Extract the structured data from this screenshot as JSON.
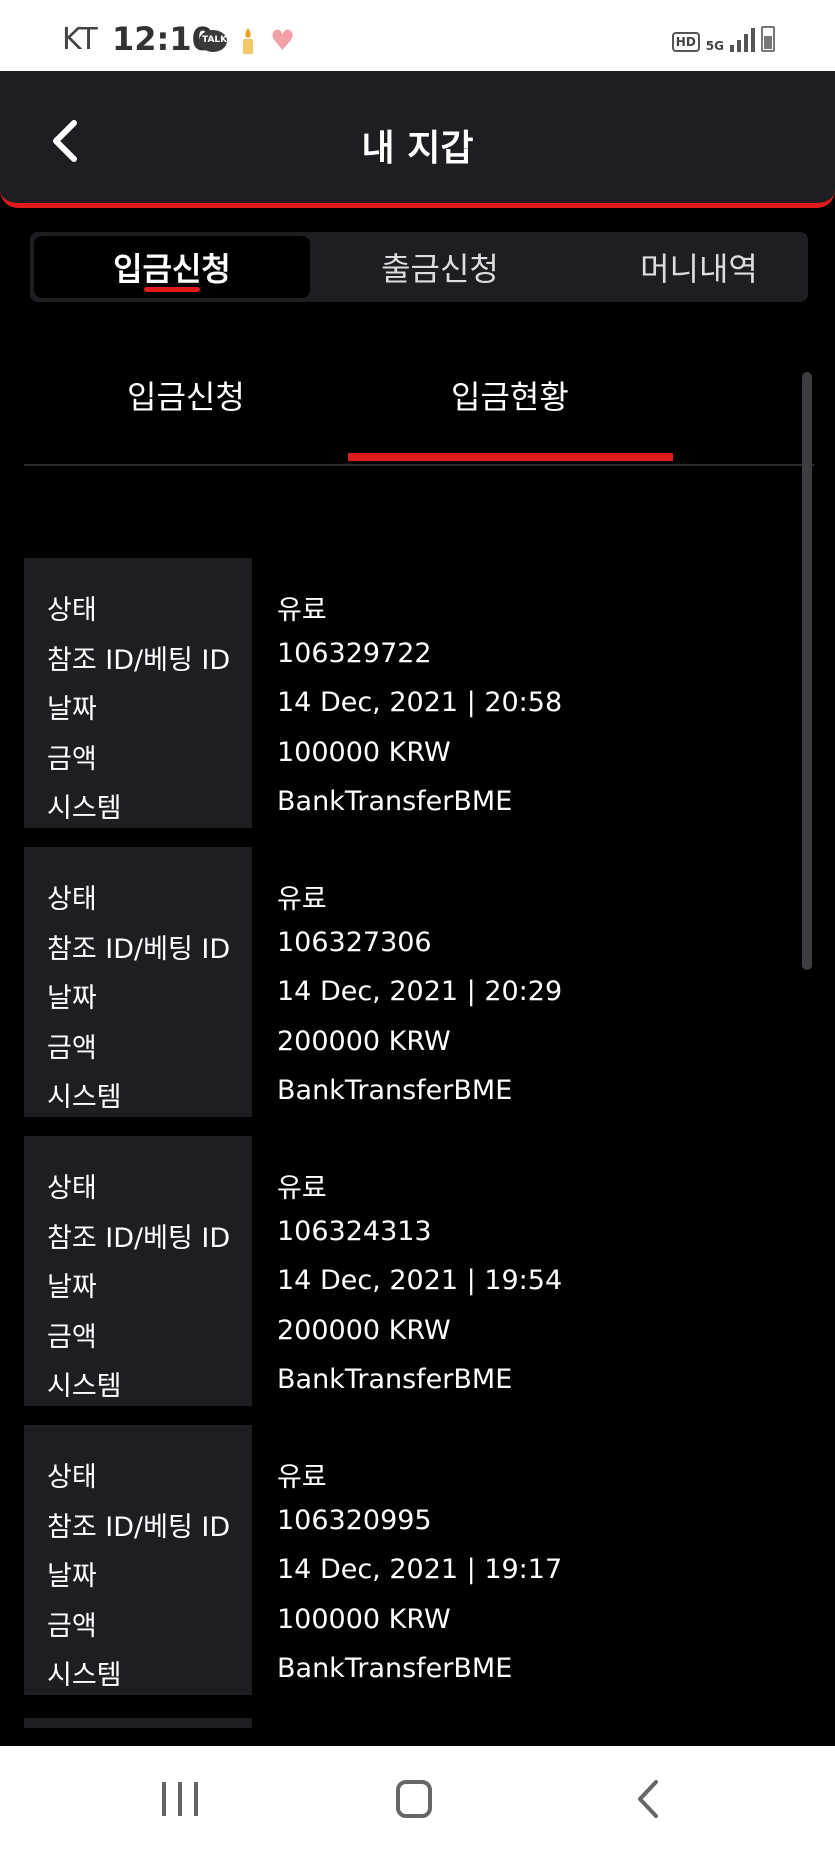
{
  "status_bar": {
    "carrier": "KT",
    "time": "12:10",
    "talk_badge": "TALK",
    "hd": "HD",
    "network": "5G"
  },
  "header": {
    "title": "내 지갑"
  },
  "top_tabs": [
    {
      "label": "입금신청",
      "active": true
    },
    {
      "label": "출금신청",
      "active": false
    },
    {
      "label": "머니내역",
      "active": false
    }
  ],
  "sub_tabs": [
    {
      "label": "입금신청",
      "active": false
    },
    {
      "label": "입금현황",
      "active": true
    }
  ],
  "field_labels": {
    "status": "상태",
    "ref_id": "참조 ID/베팅 ID",
    "date": "날짜",
    "amount": "금액",
    "system": "시스템"
  },
  "records": [
    {
      "status": "유료",
      "ref_id": "106329722",
      "date": "14 Dec, 2021 | 20:58",
      "amount": "100000 KRW",
      "system": "BankTransferBME"
    },
    {
      "status": "유료",
      "ref_id": "106327306",
      "date": "14 Dec, 2021 | 20:29",
      "amount": "200000 KRW",
      "system": "BankTransferBME"
    },
    {
      "status": "유료",
      "ref_id": "106324313",
      "date": "14 Dec, 2021 | 19:54",
      "amount": "200000 KRW",
      "system": "BankTransferBME"
    },
    {
      "status": "유료",
      "ref_id": "106320995",
      "date": "14 Dec, 2021 | 19:17",
      "amount": "100000 KRW",
      "system": "BankTransferBME"
    }
  ],
  "colors": {
    "accent": "#e01b1b",
    "panel": "#1d1e22",
    "background": "#000000"
  }
}
